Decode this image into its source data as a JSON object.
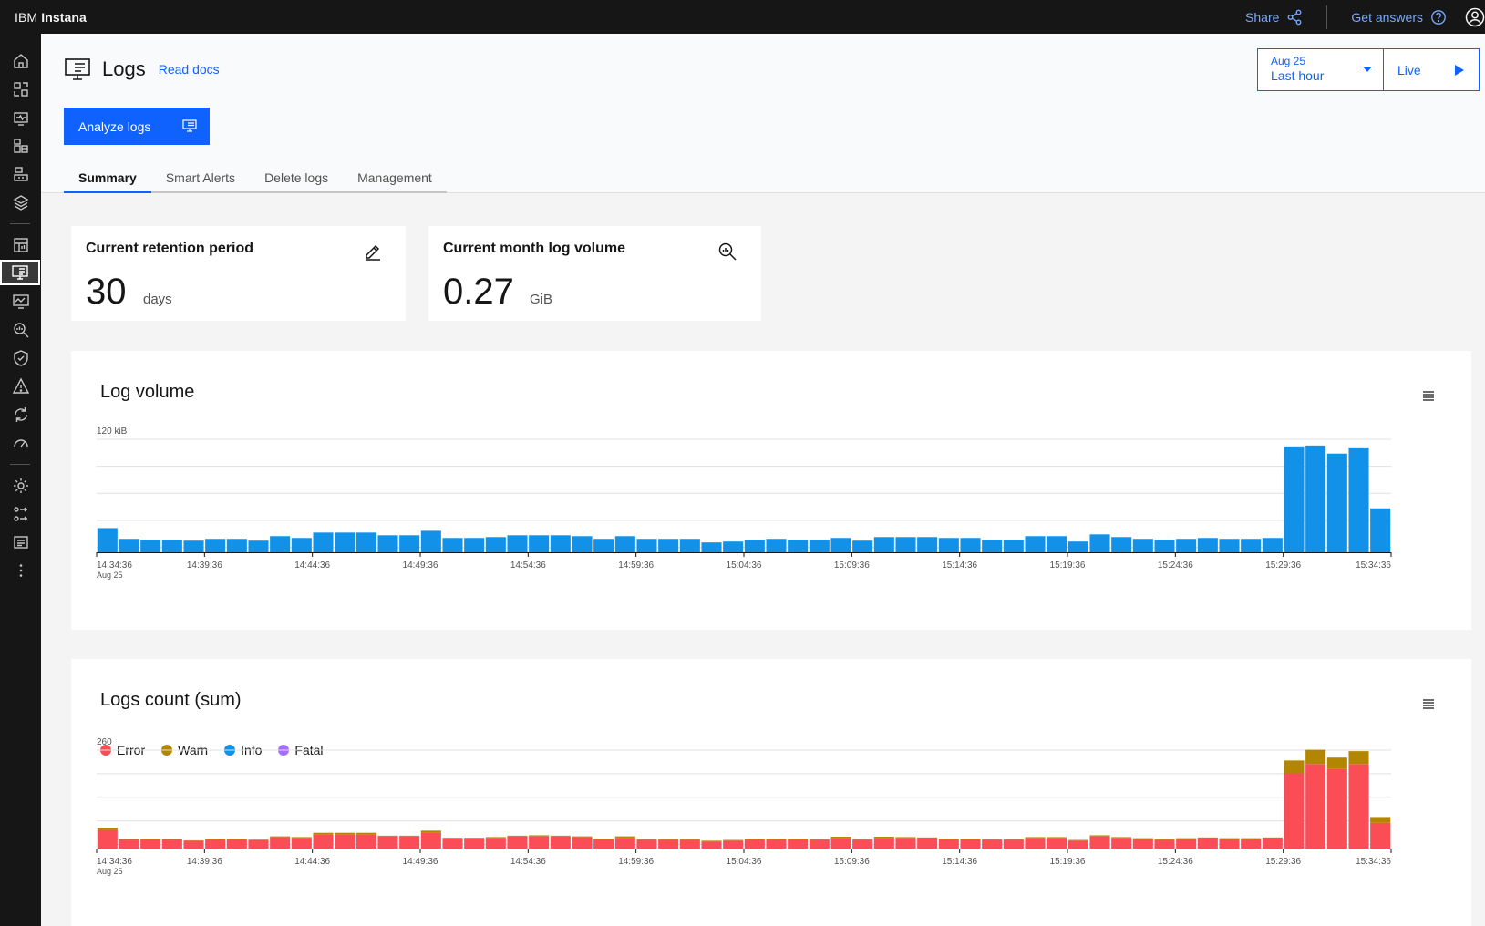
{
  "app": {
    "brand_ibm": "IBM",
    "brand_product": "Instana"
  },
  "topbar": {
    "share_label": "Share",
    "get_answers_label": "Get answers"
  },
  "rail": {
    "items": [
      "home-icon",
      "applications-icon",
      "websites-icon",
      "infrastructure-icon",
      "platforms-icon",
      "stack-icon",
      "dashboards-icon",
      "logs-icon",
      "synthetic-icon",
      "analytics-icon",
      "security-icon",
      "events-icon",
      "automation-icon",
      "performance-icon",
      "settings-icon",
      "integrations-icon",
      "documents-icon",
      "more-icon"
    ]
  },
  "header": {
    "page_title": "Logs",
    "read_docs": "Read docs",
    "analyze_button": "Analyze logs",
    "time": {
      "date": "Aug 25",
      "range": "Last hour",
      "live_label": "Live"
    },
    "tabs": [
      "Summary",
      "Smart Alerts",
      "Delete logs",
      "Management"
    ],
    "active_tab": "Summary"
  },
  "kpis": {
    "retention": {
      "title": "Current retention period",
      "value": "30",
      "unit": "days"
    },
    "volume": {
      "title": "Current month log volume",
      "value": "0.27",
      "unit": "GiB"
    }
  },
  "colors": {
    "primary": "#0f62fe",
    "bar_blue": "#1192e8",
    "error": "#fa4d56",
    "warn": "#b28600",
    "info": "#1192e8",
    "fatal": "#a56eff"
  },
  "chart_data": [
    {
      "type": "bar",
      "title": "Log volume",
      "ylabel": "120 kiB",
      "ylim": [
        0,
        128
      ],
      "grid": true,
      "x_tick_labels": [
        "14:34:36",
        "14:39:36",
        "14:44:36",
        "14:49:36",
        "14:54:36",
        "14:59:36",
        "15:04:36",
        "15:09:36",
        "15:14:36",
        "15:19:36",
        "15:24:36",
        "15:29:36",
        "15:34:36"
      ],
      "x_sublabel": "Aug 25",
      "series": [
        {
          "values": [
            27,
            15,
            14,
            14,
            13,
            15,
            15,
            13,
            18,
            16,
            22,
            22,
            22,
            19,
            19,
            24,
            16,
            16,
            17,
            19,
            19,
            19,
            18,
            15,
            18,
            15,
            15,
            15,
            11,
            12,
            14,
            15,
            14,
            14,
            16,
            13,
            17,
            17,
            17,
            16,
            16,
            14,
            14,
            18,
            18,
            12,
            20,
            17,
            15,
            14,
            15,
            16,
            15,
            15,
            16,
            118,
            119,
            110,
            117,
            49
          ]
        }
      ]
    },
    {
      "type": "bar",
      "title": "Logs count (sum)",
      "ylabel": "260",
      "ylim": [
        0,
        280
      ],
      "grid": true,
      "stacked": true,
      "legend": [
        "Error",
        "Warn",
        "Info",
        "Fatal"
      ],
      "x_tick_labels": [
        "14:34:36",
        "14:39:36",
        "14:44:36",
        "14:49:36",
        "14:54:36",
        "14:59:36",
        "15:04:36",
        "15:09:36",
        "15:14:36",
        "15:19:36",
        "15:24:36",
        "15:29:36",
        "15:34:36"
      ],
      "x_sublabel": "Aug 25",
      "series": [
        {
          "name": "Error",
          "values": [
            52,
            26,
            26,
            26,
            22,
            26,
            26,
            24,
            32,
            30,
            40,
            40,
            40,
            34,
            34,
            44,
            28,
            28,
            30,
            34,
            34,
            34,
            32,
            26,
            30,
            24,
            24,
            24,
            20,
            22,
            26,
            26,
            26,
            24,
            30,
            24,
            30,
            30,
            28,
            26,
            26,
            24,
            24,
            30,
            30,
            22,
            34,
            30,
            26,
            24,
            26,
            28,
            26,
            26,
            28,
            210,
            236,
            222,
            236,
            72
          ]
        },
        {
          "name": "Warn",
          "values": [
            6,
            1,
            2,
            1,
            1,
            2,
            2,
            1,
            2,
            2,
            4,
            4,
            4,
            2,
            2,
            6,
            2,
            2,
            2,
            2,
            3,
            2,
            2,
            2,
            4,
            2,
            3,
            3,
            2,
            2,
            2,
            2,
            2,
            2,
            3,
            2,
            3,
            2,
            3,
            2,
            2,
            2,
            2,
            2,
            2,
            2,
            3,
            2,
            3,
            3,
            3,
            3,
            3,
            3,
            3,
            36,
            40,
            32,
            36,
            16
          ]
        },
        {
          "name": "Info",
          "values": [
            0,
            0,
            0,
            0,
            0,
            0,
            0,
            0,
            0,
            0,
            0,
            0,
            0,
            0,
            0,
            0,
            0,
            0,
            0,
            0,
            0,
            0,
            0,
            0,
            0,
            0,
            0,
            0,
            0,
            0,
            0,
            0,
            0,
            0,
            0,
            0,
            0,
            0,
            0,
            0,
            0,
            0,
            0,
            0,
            0,
            0,
            0,
            0,
            0,
            0,
            0,
            0,
            0,
            0,
            0,
            0,
            0,
            0,
            0,
            0
          ]
        },
        {
          "name": "Fatal",
          "values": [
            0,
            0,
            0,
            0,
            0,
            0,
            0,
            0,
            0,
            0,
            0,
            0,
            0,
            0,
            0,
            0,
            0,
            0,
            0,
            0,
            0,
            0,
            0,
            0,
            0,
            0,
            0,
            0,
            0,
            0,
            0,
            0,
            0,
            0,
            0,
            0,
            0,
            0,
            0,
            0,
            0,
            0,
            0,
            0,
            0,
            0,
            0,
            0,
            0,
            0,
            0,
            0,
            0,
            0,
            0,
            0,
            0,
            0,
            0,
            0
          ]
        }
      ]
    }
  ]
}
